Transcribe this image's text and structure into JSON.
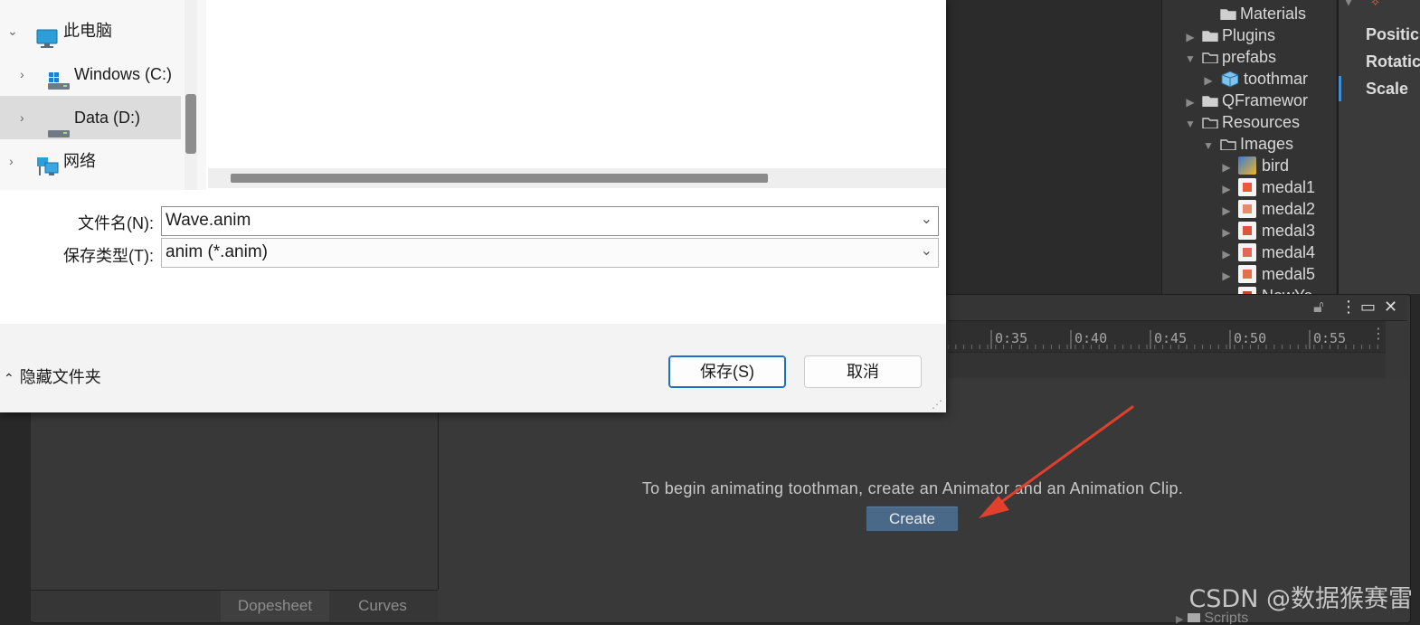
{
  "dialog": {
    "nav": [
      {
        "label": "此电脑",
        "icon": "computer-icon",
        "expanded": true
      },
      {
        "label": "Windows (C:)",
        "icon": "drive-c-icon"
      },
      {
        "label": "Data (D:)",
        "icon": "drive-icon",
        "selected": true
      },
      {
        "label": "网络",
        "icon": "network-icon"
      }
    ],
    "filename_label": "文件名(N):",
    "filename_value": "Wave.anim",
    "filetype_label": "保存类型(T):",
    "filetype_value": "anim (*.anim)",
    "hide_folders_label": "隐藏文件夹",
    "save_label": "保存(S)",
    "cancel_label": "取消"
  },
  "project_tree": [
    {
      "label": "Materials",
      "kind": "folder"
    },
    {
      "label": "Plugins",
      "kind": "folder"
    },
    {
      "label": "prefabs",
      "kind": "folder-open"
    },
    {
      "label": "toothmar",
      "kind": "prefab"
    },
    {
      "label": "QFramewor",
      "kind": "folder"
    },
    {
      "label": "Resources",
      "kind": "folder-open"
    },
    {
      "label": "Images",
      "kind": "folder-open"
    },
    {
      "label": "bird",
      "kind": "image"
    },
    {
      "label": "medal1",
      "kind": "image"
    },
    {
      "label": "medal2",
      "kind": "image"
    },
    {
      "label": "medal3",
      "kind": "image"
    },
    {
      "label": "medal4",
      "kind": "image"
    },
    {
      "label": "medal5",
      "kind": "image"
    },
    {
      "label": "NewYe",
      "kind": "image"
    }
  ],
  "inspector": {
    "position_label": "Positic",
    "rotation_label": "Rotatic",
    "scale_label": "Scale"
  },
  "timeline_ticks": [
    "0:35",
    "0:40",
    "0:45",
    "0:50",
    "0:55"
  ],
  "animation": {
    "message": "To begin animating toothman, create an Animator and an Animation Clip.",
    "create_label": "Create",
    "dopesheet_label": "Dopesheet",
    "curves_label": "Curves"
  },
  "bottom_partial_label": "Scripts",
  "watermark": "CSDN @数据猴赛雷",
  "colors": {
    "arrow": "#e0402c",
    "accent": "#1d6fc2",
    "unity_button": "#4a6887"
  }
}
